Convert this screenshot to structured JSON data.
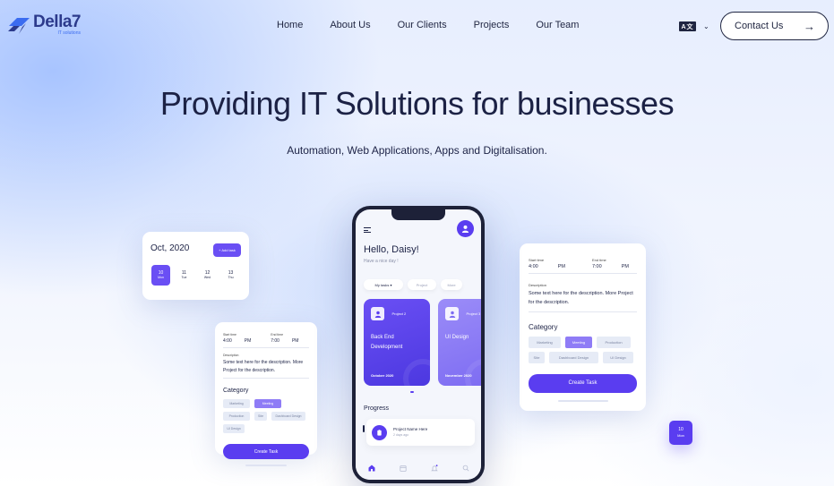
{
  "brand": {
    "name": "Della7",
    "tagline": "IT solutions"
  },
  "nav": {
    "items": [
      "Home",
      "About Us",
      "Our Clients",
      "Projects",
      "Our Team"
    ],
    "lang_label": "A文",
    "contact_label": "Contact Us",
    "contact_arrow": "→"
  },
  "hero": {
    "title": "Providing IT Solutions for businesses",
    "subtitle": "Automation, Web Applications, Apps and Digitalisation."
  },
  "calendar_card": {
    "month": "Oct, 2020",
    "add_label": "+ Add task",
    "days": [
      {
        "num": "10",
        "dow": "Mon"
      },
      {
        "num": "11",
        "dow": "Tue"
      },
      {
        "num": "12",
        "dow": "Wed"
      },
      {
        "num": "13",
        "dow": "Thu"
      }
    ]
  },
  "task_form": {
    "start_label": "Start time",
    "end_label": "End time",
    "start_time": "4:00",
    "start_ampm": "PM",
    "end_time": "7:00",
    "end_ampm": "PM",
    "desc_label": "Description",
    "description": "Some text here for the description. More Project for the description.",
    "category_label": "Category",
    "chips": [
      "Marketing",
      "Meeting",
      "Production",
      "Site",
      "Dashboard Design",
      "UI Design"
    ],
    "selected_chip": "Meeting",
    "create_label": "Create Task"
  },
  "phone": {
    "greeting": "Hello, Daisy!",
    "sub": "Have a nice day !",
    "tabs": [
      "My tasks",
      "Project",
      "More"
    ],
    "projects": [
      {
        "tag": "Project 2",
        "title": "Back End Development",
        "date": "October 2020"
      },
      {
        "tag": "Project 3",
        "title": "UI Design",
        "date": "November 2020"
      }
    ],
    "progress_label": "Progress",
    "task": {
      "name": "Project Name Here",
      "date": "2 days ago"
    }
  },
  "date_pill": {
    "num": "10",
    "dow": "Mon"
  },
  "colors": {
    "accent": "#5a3df0",
    "accent_light": "#8f7cf6",
    "text": "#1c2245"
  }
}
